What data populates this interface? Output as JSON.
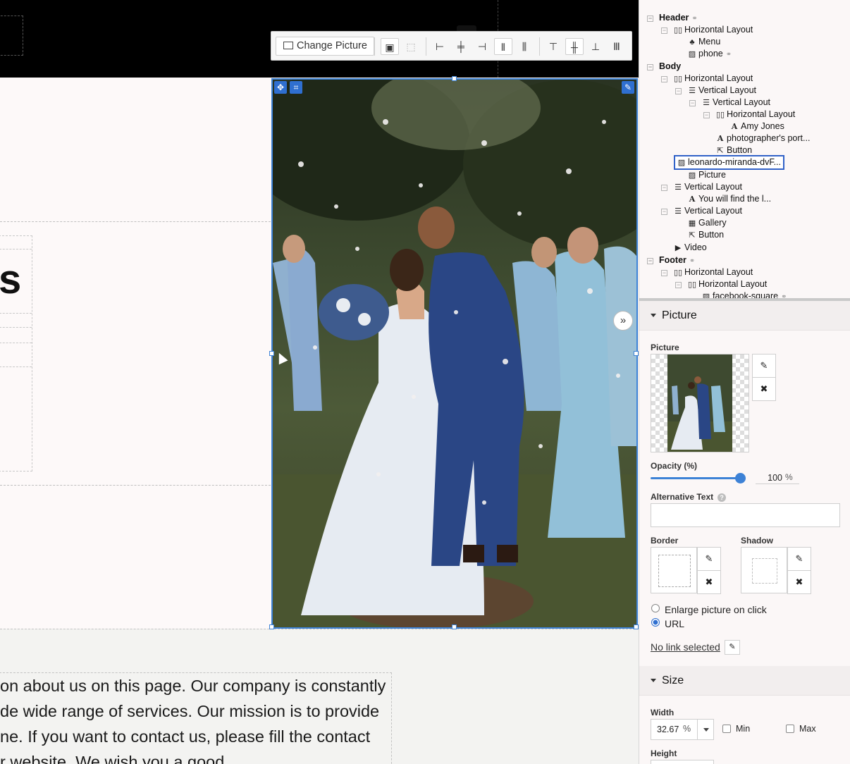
{
  "toolbar": {
    "change_picture_label": "Change Picture"
  },
  "canvas": {
    "heading_fragment": "s",
    "about_lines": [
      "on about us on this page. Our company is constantly",
      "de wide range of services. Our mission is to provide",
      "ne. If you want to contact us, please fill the contact",
      "r website. We wish you a good"
    ]
  },
  "tree": {
    "items": [
      {
        "label": "Header",
        "icon": "none"
      },
      {
        "label": "Horizontal Layout",
        "icon": "columns-icon"
      },
      {
        "label": "Menu",
        "icon": "sitemap-icon"
      },
      {
        "label": "phone",
        "icon": "image-icon"
      },
      {
        "label": "Body",
        "icon": "none"
      },
      {
        "label": "Horizontal Layout",
        "icon": "columns-icon"
      },
      {
        "label": "Vertical Layout",
        "icon": "rows-icon"
      },
      {
        "label": "Vertical Layout",
        "icon": "rows-icon"
      },
      {
        "label": "Horizontal Layout",
        "icon": "columns-icon"
      },
      {
        "label": "Amy Jones",
        "icon": "text-icon"
      },
      {
        "label": "photographer's port...",
        "icon": "text-icon"
      },
      {
        "label": "Button",
        "icon": "button-icon"
      },
      {
        "label": "leonardo-miranda-dvF...",
        "icon": "image-icon"
      },
      {
        "label": "Picture",
        "icon": "image-icon"
      },
      {
        "label": "Vertical Layout",
        "icon": "rows-icon"
      },
      {
        "label": "You will find the l...",
        "icon": "text-icon"
      },
      {
        "label": "Vertical Layout",
        "icon": "rows-icon"
      },
      {
        "label": "Gallery",
        "icon": "grid-icon"
      },
      {
        "label": "Button",
        "icon": "button-icon"
      },
      {
        "label": "Video",
        "icon": "play-icon"
      },
      {
        "label": "Footer",
        "icon": "none"
      },
      {
        "label": "Horizontal Layout",
        "icon": "columns-icon"
      },
      {
        "label": "Horizontal Layout",
        "icon": "columns-icon"
      },
      {
        "label": "facebook-square",
        "icon": "image-icon"
      }
    ],
    "selected_index": 12
  },
  "panel": {
    "picture_section_title": "Picture",
    "picture_label": "Picture",
    "opacity_label": "Opacity (%)",
    "opacity_value": "100",
    "opacity_unit": "%",
    "opacity_level": 1.0,
    "alt_text_label": "Alternative Text",
    "alt_text_value": "",
    "border_label": "Border",
    "shadow_label": "Shadow",
    "link_options": [
      {
        "label": "Enlarge picture on click",
        "selected": false
      },
      {
        "label": "URL",
        "selected": true
      }
    ],
    "no_link_label": "No link selected",
    "size_section_title": "Size",
    "width_label": "Width",
    "width_value": "32.67",
    "width_unit": "%",
    "min_label": "Min",
    "max_label": "Max",
    "height_label": "Height"
  },
  "colors": {
    "accent": "#3d82d6",
    "selection": "#3162c8",
    "header_bg": "#000000",
    "panel_bg": "#fbf7f7"
  }
}
